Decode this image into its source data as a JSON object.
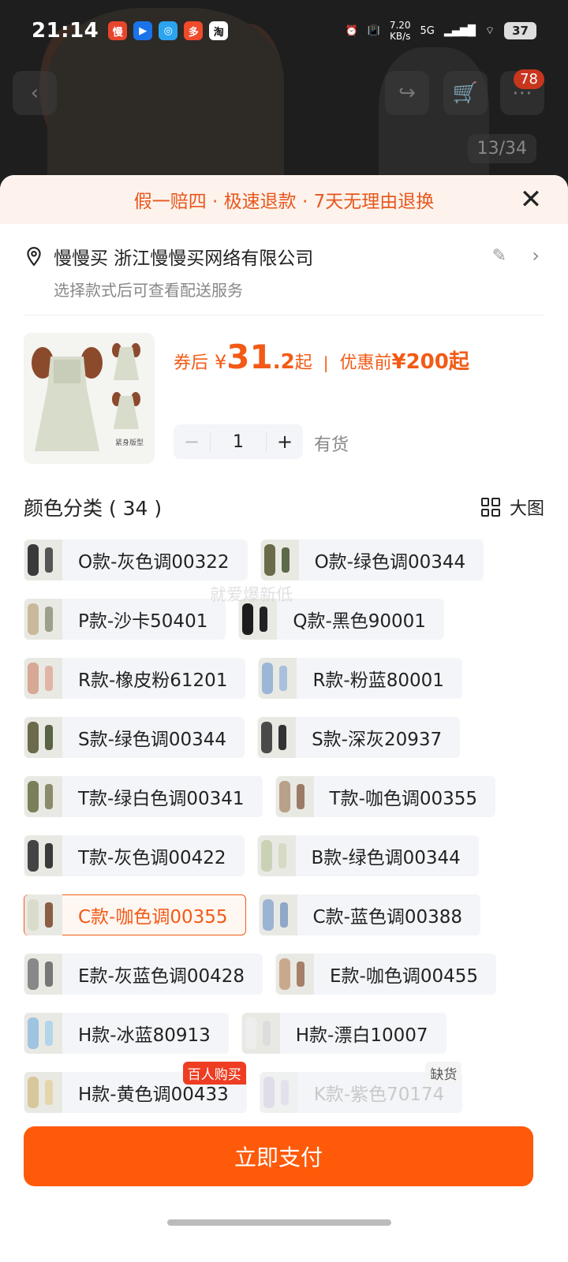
{
  "status_bar": {
    "time": "21:14",
    "apps": [
      {
        "icon": "manman-app-icon",
        "glyph": "慢",
        "color": "#e8452d"
      },
      {
        "icon": "feishu-app-icon",
        "glyph": "▶",
        "color": "#1a73e8"
      },
      {
        "icon": "chat-app-icon",
        "glyph": "◎",
        "color": "#2ba4f0"
      },
      {
        "icon": "pinduoduo-app-icon",
        "glyph": "多",
        "color": "#f04b2b"
      },
      {
        "icon": "taobao-app-icon",
        "glyph": "淘",
        "color": "#ffffff"
      }
    ],
    "net_speed": "7.20",
    "net_unit": "KB/s",
    "network": "5G",
    "battery": "37"
  },
  "nav": {
    "cart_badge": "78",
    "page_indicator": "13/34"
  },
  "sheet": {
    "banner": "假一赔四 · 极速退款 · 7天无理由退换",
    "address": {
      "line1": "慢慢买 浙江慢慢买网络有限公司",
      "line2": "选择款式后可查看配送服务"
    },
    "product": {
      "price_label": "券后",
      "currency": "¥",
      "price_int": "31",
      "price_dec": ".2",
      "price_suffix": "起",
      "orig_label": "优惠前",
      "orig_price": "¥200起",
      "quantity": "1",
      "stock": "有货",
      "thumb_caption": "紧身版型"
    },
    "category": {
      "title": "颜色分类 ( 34 )",
      "big_image": "大图"
    },
    "watermark": "就爱爆新低",
    "options": [
      {
        "label": "O款-灰色调00322",
        "c1": "#3a3a3a",
        "c2": "#555"
      },
      {
        "label": "O款-绿色调00344",
        "c1": "#6b6a4a",
        "c2": "#5d6a4a"
      },
      {
        "label": "P款-沙卡50401",
        "c1": "#c9b89a",
        "c2": "#9aa08a"
      },
      {
        "label": "Q款-黑色90001",
        "c1": "#1c1c1c",
        "c2": "#222"
      },
      {
        "label": "R款-橡皮粉61201",
        "c1": "#d7a895",
        "c2": "#e0b5a5"
      },
      {
        "label": "R款-粉蓝80001",
        "c1": "#9bb6d6",
        "c2": "#a8c0dc"
      },
      {
        "label": "S款-绿色调00344",
        "c1": "#6b6a4a",
        "c2": "#5a6345"
      },
      {
        "label": "S款-深灰20937",
        "c1": "#4a4a4a",
        "c2": "#333"
      },
      {
        "label": "T款-绿白色调00341",
        "c1": "#7a7f5a",
        "c2": "#8b8a6a"
      },
      {
        "label": "T款-咖色调00355",
        "c1": "#b9a08a",
        "c2": "#9c7b66"
      },
      {
        "label": "T款-灰色调00422",
        "c1": "#444",
        "c2": "#3a3a3a"
      },
      {
        "label": "B款-绿色调00344",
        "c1": "#c9d2b5",
        "c2": "#d5dbc4"
      },
      {
        "label": "C款-咖色调00355",
        "c1": "#d9dccb",
        "c2": "#8b5e44",
        "selected": true
      },
      {
        "label": "C款-蓝色调00388",
        "c1": "#9cb4d3",
        "c2": "#8fa8c8"
      },
      {
        "label": "E款-灰蓝色调00428",
        "c1": "#888",
        "c2": "#777"
      },
      {
        "label": "E款-咖色调00455",
        "c1": "#c9a98e",
        "c2": "#a48068"
      },
      {
        "label": "H款-冰蓝80913",
        "c1": "#9ec4e0",
        "c2": "#b4d4ea"
      },
      {
        "label": "H款-漂白10007",
        "c1": "#eee",
        "c2": "#ddd"
      },
      {
        "label": "H款-黄色调00433",
        "c1": "#d8c79a",
        "c2": "#e4d6aa",
        "tag": "百人购买"
      },
      {
        "label": "K款-紫色70174",
        "c1": "#bdb3d2",
        "c2": "#c7bedb",
        "disabled": true,
        "tag": "缺货"
      }
    ],
    "pay_button": "立即支付"
  }
}
